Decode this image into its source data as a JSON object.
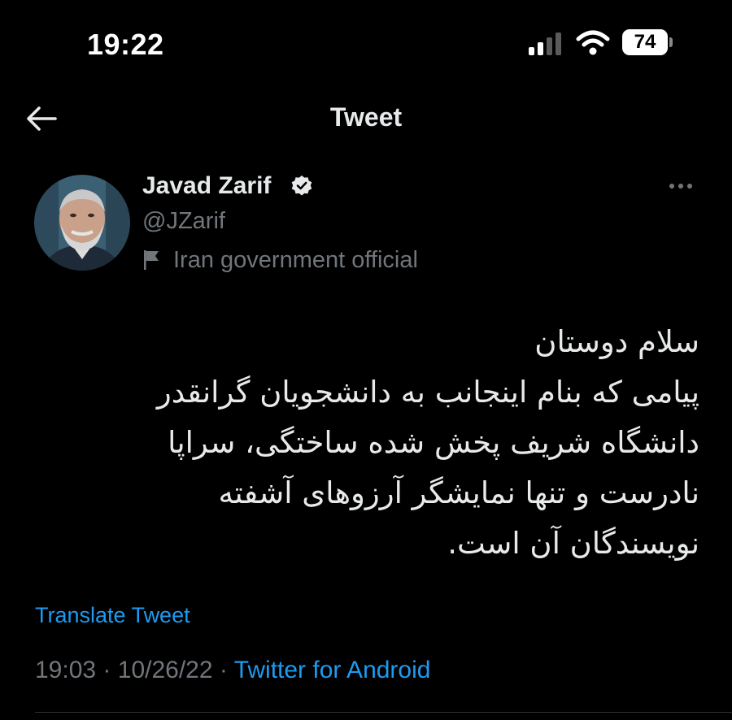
{
  "status_bar": {
    "time": "19:22",
    "battery_level": "74",
    "signal_bars_active": 2,
    "signal_bars_total": 4,
    "icons": [
      "signal-icon",
      "wifi-icon",
      "battery-icon"
    ]
  },
  "header": {
    "title": "Tweet",
    "back_icon": "arrow-left-icon"
  },
  "tweet": {
    "author": {
      "display_name": "Javad Zarif",
      "handle": "@JZarif",
      "verified": true,
      "label": "Iran government official",
      "label_icon": "flag-icon"
    },
    "lines": [
      "سلام دوستان",
      "پیامی که بنام اینجانب به دانشجویان گرانقدر",
      "دانشگاه شریف پخش شده ساختگی، سراپا",
      "نادرست و تنها نمایشگر آرزوهای آشفته",
      "نویسندگان آن است."
    ],
    "translate_label": "Translate Tweet",
    "time": "19:03",
    "separator_1": "·",
    "date": "10/26/22",
    "separator_2": "·",
    "source": "Twitter for Android"
  },
  "colors": {
    "background": "#000000",
    "text_primary": "#e7e9ea",
    "text_secondary": "#71767b",
    "accent": "#1d9bf0",
    "divider": "#2f3336"
  }
}
